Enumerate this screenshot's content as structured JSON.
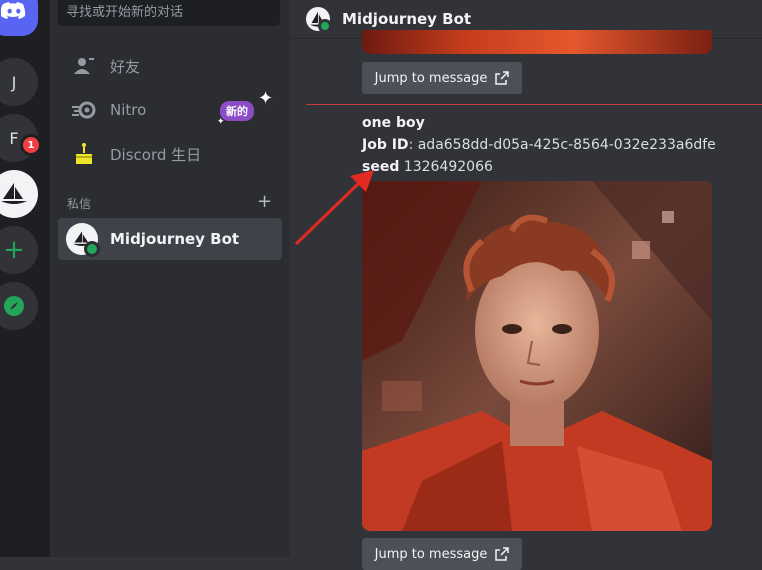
{
  "guilds": {
    "items": [
      {
        "label": "J"
      },
      {
        "label": "F",
        "badge": "1"
      }
    ]
  },
  "sidebar": {
    "search_placeholder": "寻找或开始新的对话",
    "nav": [
      {
        "label": "好友",
        "icon": "friends-icon"
      },
      {
        "label": "Nitro",
        "icon": "nitro-icon",
        "badge": "新的"
      },
      {
        "label": "Discord 生日",
        "icon": "cake-icon"
      }
    ],
    "section_title": "私信",
    "add_dm_label": "+",
    "dm": [
      {
        "label": "Midjourney Bot",
        "status": "online"
      }
    ]
  },
  "header": {
    "title": "Midjourney Bot"
  },
  "message": {
    "jump_label": "Jump to message",
    "prompt": "one boy",
    "job_label": "Job ID",
    "job_value": ": ada658dd-d05a-425c-8564-032e233a6dfe",
    "seed_label": "seed",
    "seed_value": " 1326492066"
  },
  "colors": {
    "accent": "#5865f2",
    "online": "#23a55a",
    "badge_red": "#f23f43",
    "annotation_arrow": "#e02a22"
  }
}
